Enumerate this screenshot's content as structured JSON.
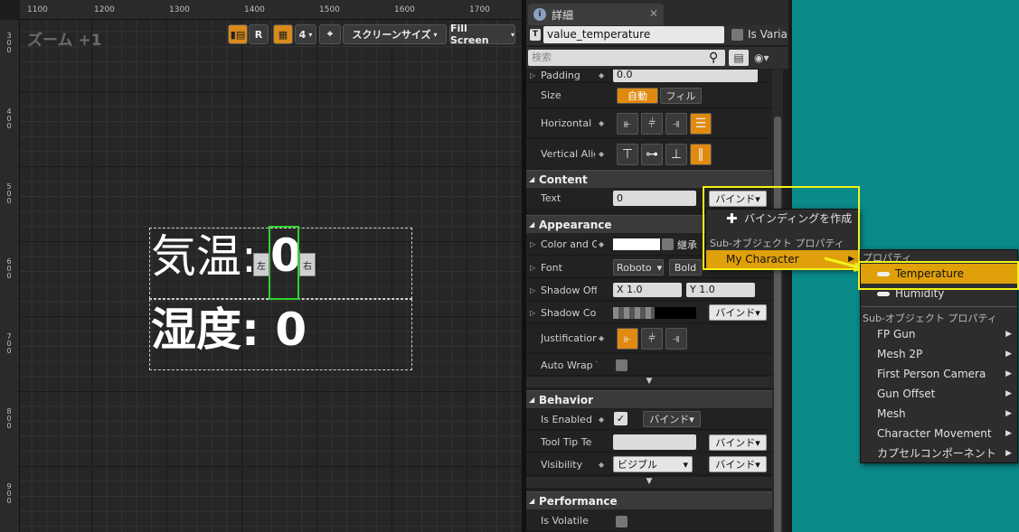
{
  "designer": {
    "zoom_label": "ズーム +1",
    "ruler_top": [
      "1100",
      "1200",
      "1300",
      "1400",
      "1500",
      "1600",
      "1700"
    ],
    "ruler_left": [
      "300",
      "400",
      "500",
      "600",
      "700",
      "800",
      "900"
    ],
    "toolbar": {
      "r_button": "R",
      "snap_value": "4",
      "screen_size": "スクリーンサイズ",
      "fill_screen": "Fill Screen"
    },
    "widgets": {
      "temp_label": "気温:",
      "temp_value": "0",
      "humidity_text": "湿度: 0",
      "handle_left": "左",
      "handle_right": "右"
    }
  },
  "details": {
    "tab_title": "詳細",
    "widget_name": "value_temperature",
    "is_variable": "Is Varia",
    "search_placeholder": "検索",
    "rows": {
      "padding_label": "Padding",
      "padding_value": "0.0",
      "size_label": "Size",
      "size_auto": "自動",
      "size_fill": "フィル",
      "horizontal_label": "Horizontal A",
      "vertical_label": "Vertical Alig",
      "content_category": "Content",
      "text_label": "Text",
      "text_value": "0",
      "bind_label": "バインド",
      "appearance_category": "Appearance",
      "color_label": "Color and O",
      "inherit_label": "継承",
      "font_label": "Font",
      "font_family": "Roboto",
      "font_style": "Bold",
      "shadow_offset_label": "Shadow Off",
      "shadow_x": "X  1.0",
      "shadow_y": "Y  1.0",
      "shadow_color_label": "Shadow Col",
      "justification_label": "Justification",
      "auto_wrap_label": "Auto Wrap T",
      "behavior_category": "Behavior",
      "is_enabled_label": "Is Enabled",
      "tooltip_label": "Tool Tip Te",
      "visibility_label": "Visibility",
      "visibility_value": "ビジブル",
      "performance_category": "Performance",
      "is_volatile_label": "Is Volatile"
    }
  },
  "bind_menu": {
    "create_binding": "バインディングを作成",
    "sub_object_header": "Sub-オブジェクト プロパティ",
    "my_character": "My Character"
  },
  "sub_menu": {
    "header": "プロパティ",
    "items": [
      "Temperature",
      "Humidity"
    ],
    "sub_header": "Sub-オブジェクト プロパティ",
    "components": [
      "FP Gun",
      "Mesh 2P",
      "First Person Camera",
      "Gun Offset",
      "Mesh",
      "Character Movement",
      "カプセルコンポーネント"
    ]
  },
  "colors": {
    "accent_orange": "#e08a10",
    "highlight_yellow": "#f3f31a",
    "selection_green": "#2ed52e",
    "background_teal": "#0b8a8a"
  }
}
